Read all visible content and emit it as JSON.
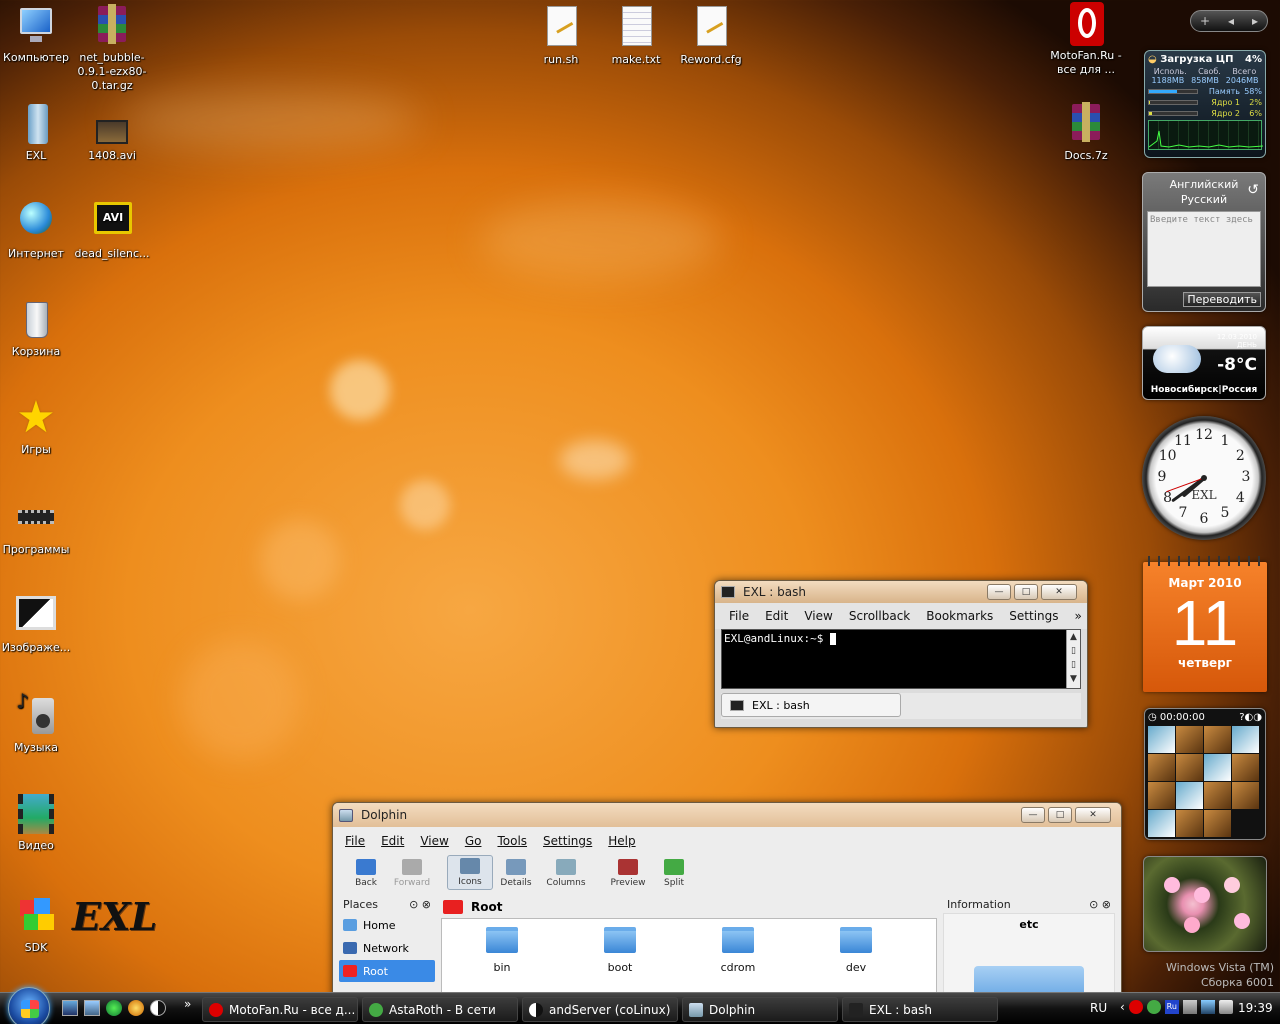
{
  "desktop_icons": [
    {
      "label": "Компьютер",
      "icon": "computer-icon"
    },
    {
      "label": "net_bubble-0.9.1-ezx80-0.tar.gz",
      "icon": "winrar-archive-icon"
    },
    {
      "label": "EXL",
      "icon": "folder-icon"
    },
    {
      "label": "1408.avi",
      "icon": "video-file-icon"
    },
    {
      "label": "Интернет",
      "icon": "internet-globe-icon"
    },
    {
      "label": "dead_silenc...",
      "icon": "avi-file-icon"
    },
    {
      "label": "Корзина",
      "icon": "recycle-bin-icon"
    },
    {
      "label": "Игры",
      "icon": "games-star-icon"
    },
    {
      "label": "Программы",
      "icon": "programs-chip-icon"
    },
    {
      "label": "Изображе...",
      "icon": "images-monitor-icon"
    },
    {
      "label": "Музыка",
      "icon": "music-speaker-icon"
    },
    {
      "label": "Видео",
      "icon": "video-filmstrip-icon"
    },
    {
      "label": "SDK",
      "icon": "sdk-icon"
    },
    {
      "label": "run.sh",
      "icon": "script-file-icon"
    },
    {
      "label": "make.txt",
      "icon": "text-file-icon"
    },
    {
      "label": "Reword.cfg",
      "icon": "config-file-icon"
    },
    {
      "label": "MotoFan.Ru - все для ...",
      "icon": "opera-icon"
    },
    {
      "label": "Docs.7z",
      "icon": "winrar-archive-icon"
    }
  ],
  "exl_logo": "EXL",
  "terminal": {
    "title": "EXL : bash",
    "menu": [
      "File",
      "Edit",
      "View",
      "Scrollback",
      "Bookmarks",
      "Settings"
    ],
    "more": "»",
    "prompt": "EXL@andLinux:~$",
    "tab_label": "EXL : bash"
  },
  "dolphin": {
    "title": "Dolphin",
    "menu": [
      "File",
      "Edit",
      "View",
      "Go",
      "Tools",
      "Settings",
      "Help"
    ],
    "toolbar": [
      "Back",
      "Forward",
      "Icons",
      "Details",
      "Columns",
      "Preview",
      "Split"
    ],
    "places_title": "Places",
    "places": [
      "Home",
      "Network",
      "Root"
    ],
    "location": "Root",
    "folders": [
      "bin",
      "boot",
      "cdrom",
      "dev"
    ],
    "info_title": "Information",
    "info_name": "etc"
  },
  "cpu_gadget": {
    "title": "Загрузка ЦП",
    "cpu_percent": "4%",
    "col_used": "Исполь.",
    "col_free": "Своб.",
    "col_total": "Всего",
    "used": "1188MB",
    "free": "858MB",
    "total": "2046MB",
    "rows": [
      {
        "label": "Память",
        "value": "58%",
        "level": 0.58
      },
      {
        "label": "Ядро 1",
        "value": "2%",
        "level": 0.02
      },
      {
        "label": "Ядро 2",
        "value": "6%",
        "level": 0.06
      }
    ]
  },
  "translator": {
    "from": "Английский",
    "to": "Русский",
    "placeholder": "Введите текст здесь",
    "button": "Переводить"
  },
  "weather": {
    "date": "12.03.2010",
    "period": "ДЕНЬ",
    "temp": "-8°C",
    "location": "Новосибирск|Россия"
  },
  "clock": {
    "brand": "EXL",
    "numbers": [
      "12",
      "1",
      "2",
      "3",
      "4",
      "5",
      "6",
      "7",
      "8",
      "9",
      "10",
      "11"
    ],
    "time": "19:39"
  },
  "calendar": {
    "month": "Март 2010",
    "day": "11",
    "weekday": "четверг"
  },
  "puzzle": {
    "timer": "00:00:00"
  },
  "watermark": {
    "line1": "Windows Vista (TM)",
    "line2": "Сборка 6001"
  },
  "sidebar_controls": {
    "add": "+",
    "prev": "◂",
    "next": "▸"
  },
  "taskbar": {
    "more": "»",
    "buttons": [
      "MotoFan.Ru - все д...",
      "AstaRoth - В сети",
      "andServer (coLinux)",
      "Dolphin",
      "EXL : bash"
    ],
    "lang": "RU",
    "time": "19:39"
  },
  "colors": {
    "accent": "#e8701a",
    "taskbar": "#111111"
  }
}
